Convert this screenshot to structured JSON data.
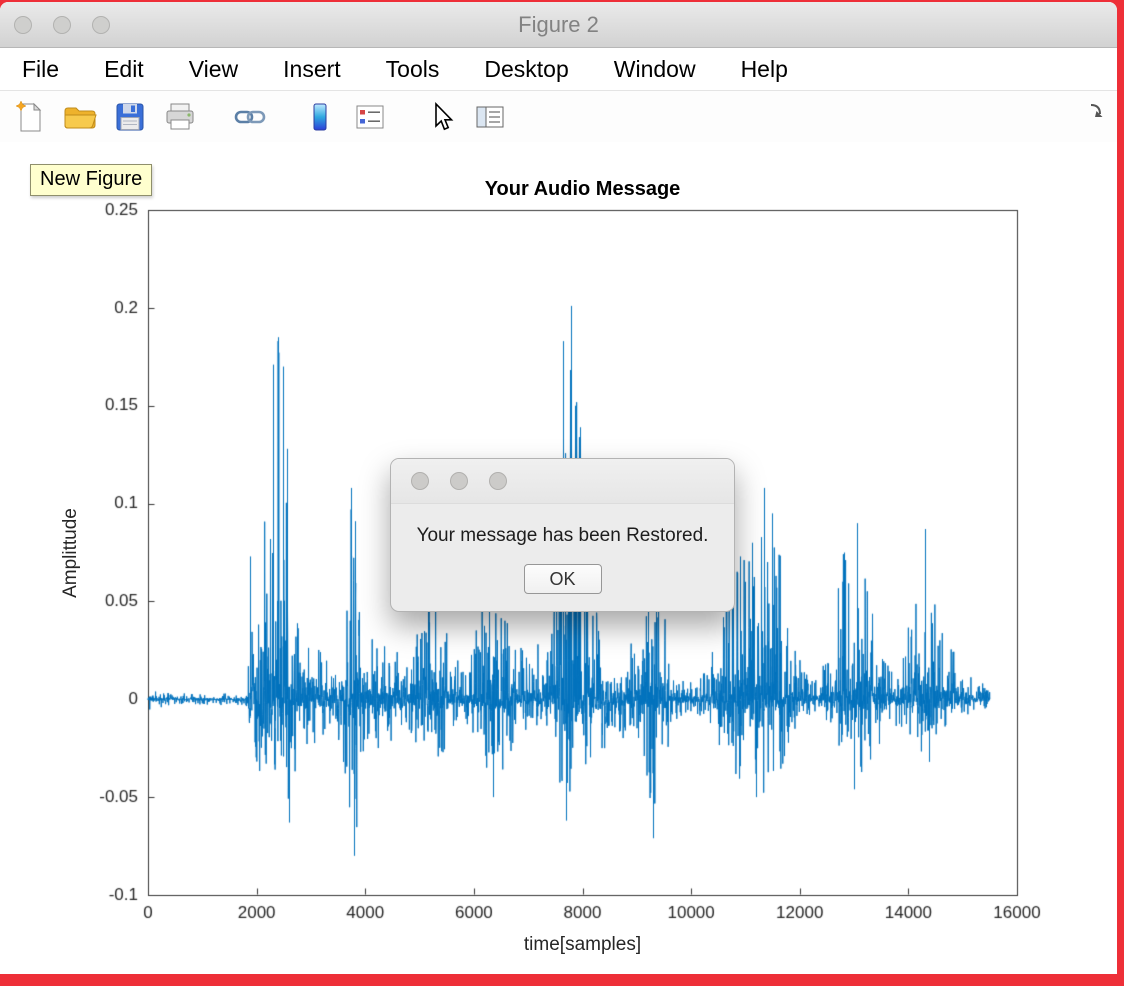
{
  "window": {
    "title": "Figure 2"
  },
  "menu_bar": {
    "items": [
      "File",
      "Edit",
      "View",
      "Insert",
      "Tools",
      "Desktop",
      "Window",
      "Help"
    ]
  },
  "toolbar": {
    "buttons": [
      {
        "name": "new-figure",
        "tooltip": "New Figure"
      },
      {
        "name": "open-file"
      },
      {
        "name": "save-figure"
      },
      {
        "name": "print-figure"
      },
      {
        "name": "link-plot"
      },
      {
        "name": "insert-colorbar"
      },
      {
        "name": "insert-legend"
      },
      {
        "name": "edit-plot"
      },
      {
        "name": "property-inspector"
      },
      {
        "name": "dock-figure"
      }
    ]
  },
  "tooltip": {
    "text": "New Figure"
  },
  "dialog": {
    "message": "Your message has been Restored.",
    "ok_label": "OK"
  },
  "colors": {
    "waveform_blue": "#0072BD",
    "desktop_red": "#ee2f38",
    "axis_text": "#262626"
  },
  "chart_data": {
    "type": "line",
    "title": "Your Audio Message",
    "xlabel": "time[samples]",
    "ylabel": "Amplittude",
    "xlim": [
      0,
      16000
    ],
    "ylim": [
      -0.1,
      0.25
    ],
    "xtick_values": [
      0,
      2000,
      4000,
      6000,
      8000,
      10000,
      12000,
      14000,
      16000
    ],
    "xtick_labels": [
      "0",
      "2000",
      "4000",
      "6000",
      "8000",
      "10000",
      "12000",
      "14000",
      "16000"
    ],
    "ytick_values": [
      -0.1,
      -0.05,
      0,
      0.05,
      0.1,
      0.15,
      0.2,
      0.25
    ],
    "ytick_labels": [
      "-0.1",
      "-0.05",
      "0",
      "0.05",
      "0.1",
      "0.15",
      "0.2",
      "0.25"
    ],
    "grid": false,
    "line_color": "#0072BD",
    "note": "speech audio waveform; encoded as positive/negative amplitude envelope control points [x, posAmp, negAmp] plus explicit prominent peak spikes [x, amplitude]",
    "waveform_envelope": {
      "x_end": 15500,
      "points": [
        [
          0,
          0.006,
          0.006
        ],
        [
          300,
          0.004,
          0.004
        ],
        [
          700,
          0.003,
          0.003
        ],
        [
          1800,
          0.003,
          0.003
        ],
        [
          1850,
          0.03,
          0.02
        ],
        [
          1900,
          0.055,
          0.035
        ],
        [
          2000,
          0.05,
          0.04
        ],
        [
          2100,
          0.07,
          0.045
        ],
        [
          2200,
          0.12,
          0.05
        ],
        [
          2300,
          0.16,
          0.055
        ],
        [
          2400,
          0.185,
          0.06
        ],
        [
          2500,
          0.165,
          0.062
        ],
        [
          2600,
          0.1,
          0.055
        ],
        [
          2700,
          0.055,
          0.04
        ],
        [
          2850,
          0.038,
          0.03
        ],
        [
          3000,
          0.032,
          0.026
        ],
        [
          3200,
          0.024,
          0.02
        ],
        [
          3400,
          0.022,
          0.018
        ],
        [
          3550,
          0.035,
          0.025
        ],
        [
          3650,
          0.07,
          0.045
        ],
        [
          3750,
          0.108,
          0.065
        ],
        [
          3820,
          0.09,
          0.08
        ],
        [
          3900,
          0.055,
          0.045
        ],
        [
          4000,
          0.035,
          0.028
        ],
        [
          4200,
          0.03,
          0.025
        ],
        [
          4400,
          0.032,
          0.027
        ],
        [
          4600,
          0.027,
          0.022
        ],
        [
          4800,
          0.02,
          0.017
        ],
        [
          4950,
          0.032,
          0.024
        ],
        [
          5100,
          0.06,
          0.035
        ],
        [
          5200,
          0.072,
          0.04
        ],
        [
          5350,
          0.055,
          0.034
        ],
        [
          5500,
          0.035,
          0.026
        ],
        [
          5650,
          0.022,
          0.017
        ],
        [
          5850,
          0.018,
          0.014
        ],
        [
          6000,
          0.03,
          0.022
        ],
        [
          6150,
          0.06,
          0.036
        ],
        [
          6300,
          0.09,
          0.046
        ],
        [
          6450,
          0.08,
          0.042
        ],
        [
          6600,
          0.05,
          0.032
        ],
        [
          6750,
          0.032,
          0.023
        ],
        [
          6950,
          0.024,
          0.018
        ],
        [
          7150,
          0.028,
          0.021
        ],
        [
          7350,
          0.032,
          0.024
        ],
        [
          7500,
          0.07,
          0.04
        ],
        [
          7600,
          0.15,
          0.055
        ],
        [
          7700,
          0.185,
          0.06
        ],
        [
          7800,
          0.201,
          0.062
        ],
        [
          7900,
          0.155,
          0.055
        ],
        [
          8000,
          0.14,
          0.05
        ],
        [
          8100,
          0.09,
          0.04
        ],
        [
          8200,
          0.055,
          0.033
        ],
        [
          8350,
          0.038,
          0.027
        ],
        [
          8550,
          0.03,
          0.022
        ],
        [
          8750,
          0.026,
          0.02
        ],
        [
          8950,
          0.036,
          0.027
        ],
        [
          9100,
          0.06,
          0.04
        ],
        [
          9250,
          0.075,
          0.055
        ],
        [
          9350,
          0.093,
          0.07
        ],
        [
          9450,
          0.06,
          0.042
        ],
        [
          9600,
          0.03,
          0.021
        ],
        [
          9800,
          0.013,
          0.01
        ],
        [
          10000,
          0.009,
          0.007
        ],
        [
          10200,
          0.011,
          0.009
        ],
        [
          10400,
          0.03,
          0.02
        ],
        [
          10550,
          0.055,
          0.032
        ],
        [
          10700,
          0.065,
          0.038
        ],
        [
          10850,
          0.07,
          0.04
        ],
        [
          11000,
          0.075,
          0.043
        ],
        [
          11150,
          0.08,
          0.045
        ],
        [
          11300,
          0.095,
          0.047
        ],
        [
          11450,
          0.108,
          0.05
        ],
        [
          11600,
          0.088,
          0.044
        ],
        [
          11750,
          0.05,
          0.03
        ],
        [
          11900,
          0.026,
          0.018
        ],
        [
          12100,
          0.016,
          0.012
        ],
        [
          12300,
          0.013,
          0.01
        ],
        [
          12500,
          0.022,
          0.015
        ],
        [
          12650,
          0.05,
          0.028
        ],
        [
          12800,
          0.075,
          0.038
        ],
        [
          12950,
          0.082,
          0.044
        ],
        [
          13100,
          0.09,
          0.042
        ],
        [
          13250,
          0.07,
          0.038
        ],
        [
          13400,
          0.05,
          0.03
        ],
        [
          13550,
          0.03,
          0.019
        ],
        [
          13700,
          0.018,
          0.013
        ],
        [
          13900,
          0.026,
          0.017
        ],
        [
          14050,
          0.045,
          0.026
        ],
        [
          14200,
          0.065,
          0.03
        ],
        [
          14350,
          0.087,
          0.033
        ],
        [
          14500,
          0.06,
          0.028
        ],
        [
          14650,
          0.04,
          0.022
        ],
        [
          14800,
          0.026,
          0.015
        ],
        [
          15000,
          0.018,
          0.011
        ],
        [
          15200,
          0.012,
          0.008
        ],
        [
          15400,
          0.008,
          0.006
        ],
        [
          15500,
          0.005,
          0.004
        ]
      ]
    },
    "peaks": [
      [
        1870,
        0.073
      ],
      [
        2310,
        0.171
      ],
      [
        2400,
        0.185
      ],
      [
        2480,
        0.17
      ],
      [
        2560,
        0.128
      ],
      [
        2600,
        -0.063
      ],
      [
        3740,
        0.108
      ],
      [
        3810,
        0.091
      ],
      [
        3800,
        -0.08
      ],
      [
        5150,
        0.073
      ],
      [
        6280,
        0.09
      ],
      [
        6350,
        -0.05
      ],
      [
        7640,
        0.183
      ],
      [
        7790,
        0.201
      ],
      [
        7860,
        0.15
      ],
      [
        7950,
        0.139
      ],
      [
        7700,
        -0.062
      ],
      [
        9200,
        0.075
      ],
      [
        9350,
        0.093
      ],
      [
        9300,
        -0.071
      ],
      [
        10900,
        0.073
      ],
      [
        11120,
        0.08
      ],
      [
        11340,
        0.108
      ],
      [
        11480,
        0.095
      ],
      [
        11200,
        -0.05
      ],
      [
        12820,
        0.075
      ],
      [
        13060,
        0.09
      ],
      [
        13000,
        -0.046
      ],
      [
        14300,
        0.087
      ],
      [
        14380,
        -0.032
      ]
    ]
  }
}
